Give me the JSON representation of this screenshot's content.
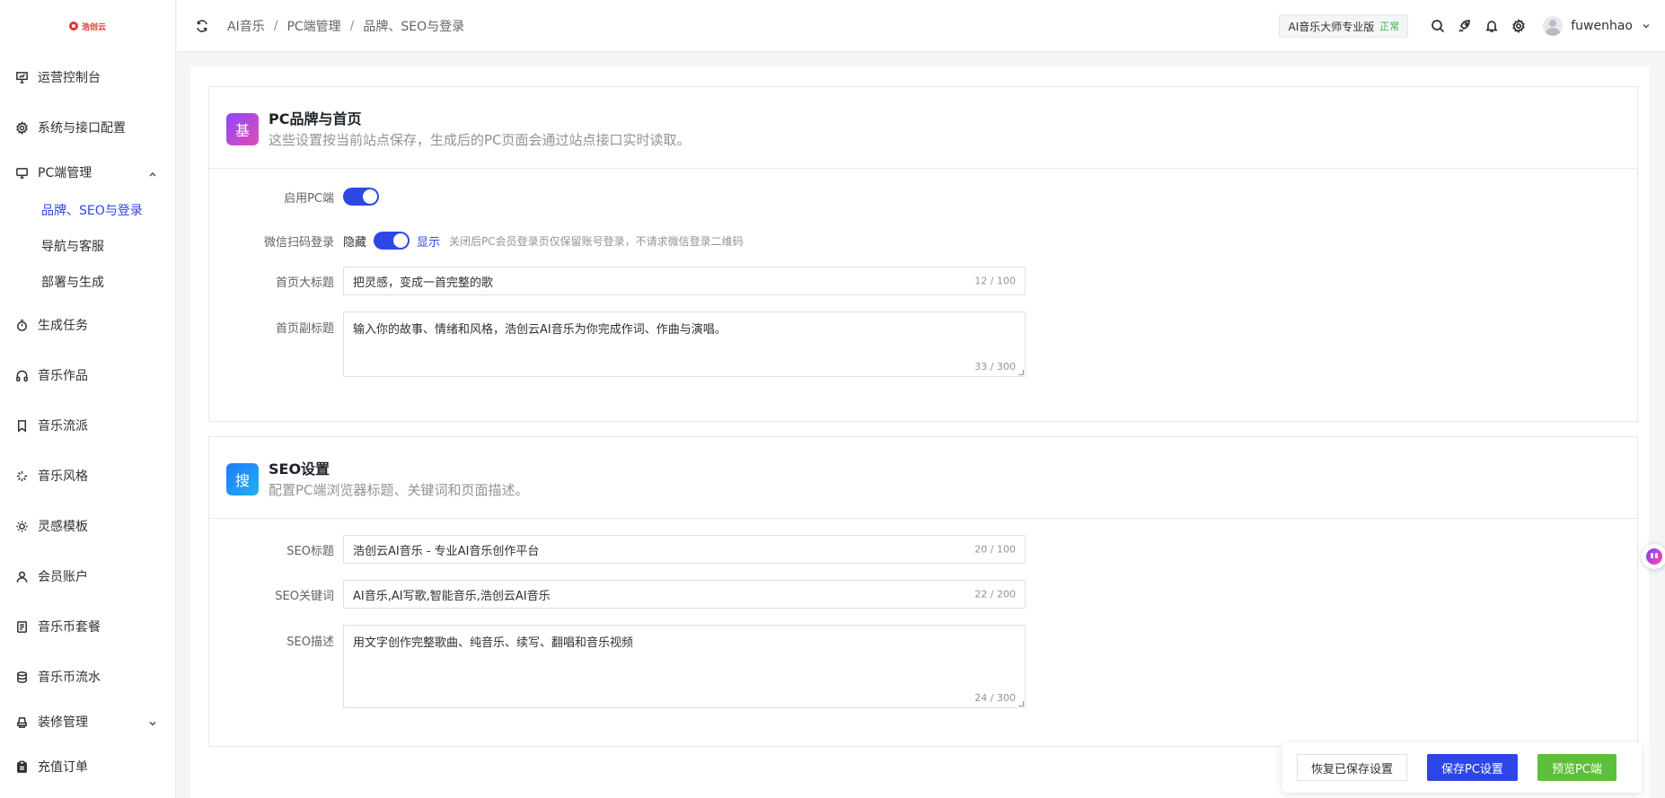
{
  "brand": {
    "logo_text": "浩创云"
  },
  "sidebar": {
    "items": [
      {
        "label": "运营控制台",
        "icon": "presentation-chart-icon"
      },
      {
        "label": "系统与接口配置",
        "icon": "gear-icon"
      },
      {
        "label": "PC端管理",
        "icon": "monitor-icon",
        "expanded": true,
        "children": [
          {
            "label": "品牌、SEO与登录",
            "active": true
          },
          {
            "label": "导航与客服"
          },
          {
            "label": "部署与生成"
          }
        ]
      },
      {
        "label": "生成任务",
        "icon": "stopwatch-icon"
      },
      {
        "label": "音乐作品",
        "icon": "headphones-icon"
      },
      {
        "label": "音乐流派",
        "icon": "bookmark-icon"
      },
      {
        "label": "音乐风格",
        "icon": "loading-icon"
      },
      {
        "label": "灵感模板",
        "icon": "sun-icon"
      },
      {
        "label": "会员账户",
        "icon": "user-icon"
      },
      {
        "label": "音乐币套餐",
        "icon": "document-icon"
      },
      {
        "label": "音乐币流水",
        "icon": "coins-icon"
      },
      {
        "label": "装修管理",
        "icon": "brush-icon",
        "expanded": false
      },
      {
        "label": "充值订单",
        "icon": "clipboard-icon"
      }
    ]
  },
  "header": {
    "breadcrumb": [
      "AI音乐",
      "PC端管理",
      "品牌、SEO与登录"
    ],
    "plan_label": "AI音乐大师专业版",
    "plan_status": "正常",
    "username": "fuwenhao"
  },
  "brand_section": {
    "badge": "基",
    "title": "PC品牌与首页",
    "description": "这些设置按当前站点保存，生成后的PC页面会通过站点接口实时读取。",
    "enable_pc": {
      "label": "启用PC端",
      "value": true
    },
    "wechat_login": {
      "label": "微信扫码登录",
      "off_text": "隐藏",
      "on_text": "显示",
      "value": true,
      "hint": "关闭后PC会员登录页仅保留账号登录，不请求微信登录二维码"
    },
    "home_title": {
      "label": "首页大标题",
      "value": "把灵感，变成一首完整的歌",
      "count": "12 / 100"
    },
    "home_subtitle": {
      "label": "首页副标题",
      "value": "输入你的故事、情绪和风格，浩创云AI音乐为你完成作词、作曲与演唱。",
      "count": "33 / 300"
    }
  },
  "seo_section": {
    "badge": "搜",
    "title": "SEO设置",
    "description": "配置PC端浏览器标题、关键词和页面描述。",
    "seo_title": {
      "label": "SEO标题",
      "value": "浩创云AI音乐 - 专业AI音乐创作平台",
      "count": "20 / 100"
    },
    "seo_keywords": {
      "label": "SEO关键词",
      "value": "AI音乐,AI写歌,智能音乐,浩创云AI音乐",
      "count": "22 / 200"
    },
    "seo_description": {
      "label": "SEO描述",
      "value": "用文字创作完整歌曲、纯音乐、续写、翻唱和音乐视频",
      "count": "24 / 300"
    }
  },
  "footer": {
    "restore_label": "恢复已保存设置",
    "save_label": "保存PC设置",
    "preview_label": "预览PC端"
  },
  "colors": {
    "primary": "#2d47e6",
    "success": "#5cc03a",
    "brand_red": "#e3342f"
  }
}
